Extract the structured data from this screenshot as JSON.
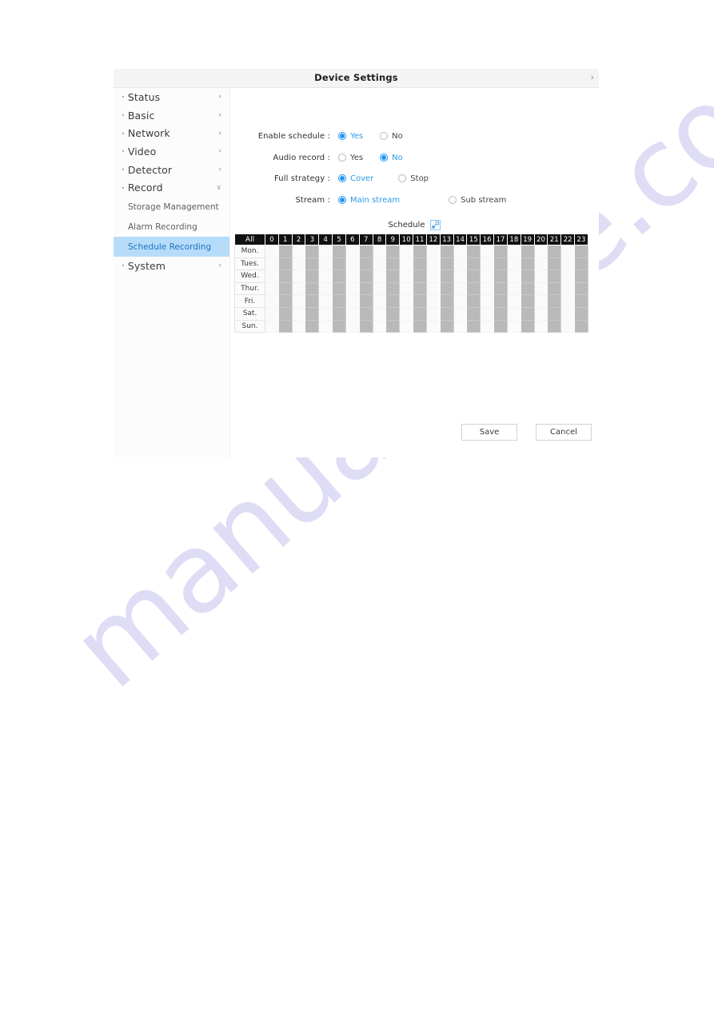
{
  "watermark": {
    "text": "manualshive.com"
  },
  "header": {
    "title": "Device Settings",
    "chevron": "›"
  },
  "sidebar": {
    "items": [
      {
        "bullet": "·",
        "label": "Status",
        "chevron": "›",
        "expanded": false
      },
      {
        "bullet": "·",
        "label": "Basic",
        "chevron": "›",
        "expanded": false
      },
      {
        "bullet": "·",
        "label": "Network",
        "chevron": "›",
        "expanded": false
      },
      {
        "bullet": "·",
        "label": "Video",
        "chevron": "›",
        "expanded": false
      },
      {
        "bullet": "·",
        "label": "Detector",
        "chevron": "›",
        "expanded": false
      },
      {
        "bullet": "·",
        "label": "Record",
        "chevron": "∨",
        "expanded": true
      }
    ],
    "sub_items": [
      {
        "label": "Storage Management",
        "active": false
      },
      {
        "label": "Alarm Recording",
        "active": false
      },
      {
        "label": "Schedule Recording",
        "active": true
      }
    ],
    "system_item": {
      "bullet": "·",
      "label": "System",
      "chevron": "›"
    }
  },
  "form": {
    "rows": [
      {
        "label": "Enable schedule :",
        "options": [
          {
            "text": "Yes",
            "selected": true
          },
          {
            "text": "No",
            "selected": false
          }
        ]
      },
      {
        "label": "Audio record :",
        "options": [
          {
            "text": "Yes",
            "selected": false
          },
          {
            "text": "No",
            "selected": true
          }
        ]
      },
      {
        "label": "Full strategy :",
        "options": [
          {
            "text": "Cover",
            "selected": true
          },
          {
            "text": "Stop",
            "selected": false
          }
        ]
      },
      {
        "label": "Stream :",
        "options": [
          {
            "text": "Main stream",
            "selected": true
          },
          {
            "text": "Sub stream",
            "selected": false
          }
        ]
      }
    ]
  },
  "schedule": {
    "title": "Schedule",
    "expand_icon": "expand-icon",
    "all_label": "All",
    "hours": [
      "0",
      "1",
      "2",
      "3",
      "4",
      "5",
      "6",
      "7",
      "8",
      "9",
      "10",
      "11",
      "12",
      "13",
      "14",
      "15",
      "16",
      "17",
      "18",
      "19",
      "20",
      "21",
      "22",
      "23"
    ],
    "days": [
      "Mon.",
      "Tues.",
      "Wed.",
      "Thur.",
      "Fri.",
      "Sat.",
      "Sun."
    ],
    "selected_hours": [
      1,
      3,
      5,
      7,
      9,
      11,
      13,
      15,
      17,
      19,
      21,
      23
    ]
  },
  "footer": {
    "save_label": "Save",
    "cancel_label": "Cancel"
  },
  "colors": {
    "accent": "#2196f3",
    "accent_text": "#2b9ae8",
    "active_nav_bg": "#b7dcfa",
    "active_nav_text": "#1b74c4",
    "grid_header_bg": "#111111",
    "grid_selected": "#b9b9b9",
    "watermark": "#cac9ef"
  }
}
